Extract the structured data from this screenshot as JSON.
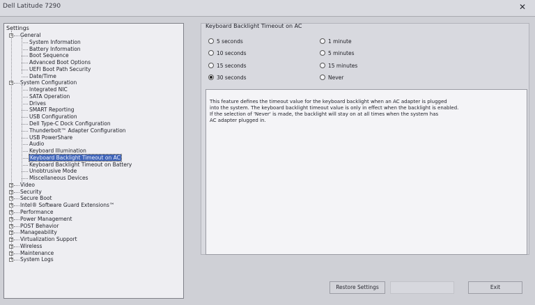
{
  "window": {
    "title": "Dell Latitude 7290",
    "close_glyph": "✕"
  },
  "tree": {
    "root_label": "Settings",
    "items": [
      {
        "label": "General",
        "level": 0,
        "expander": "−"
      },
      {
        "label": "System Information",
        "level": 1
      },
      {
        "label": "Battery Information",
        "level": 1
      },
      {
        "label": "Boot Sequence",
        "level": 1
      },
      {
        "label": "Advanced Boot Options",
        "level": 1
      },
      {
        "label": "UEFI Boot Path Security",
        "level": 1
      },
      {
        "label": "Date/Time",
        "level": 1
      },
      {
        "label": "System Configuration",
        "level": 0,
        "expander": "−"
      },
      {
        "label": "Integrated NIC",
        "level": 1
      },
      {
        "label": "SATA Operation",
        "level": 1
      },
      {
        "label": "Drives",
        "level": 1
      },
      {
        "label": "SMART Reporting",
        "level": 1
      },
      {
        "label": "USB Configuration",
        "level": 1
      },
      {
        "label": "Dell Type-C Dock Configuration",
        "level": 1
      },
      {
        "label": "Thunderbolt™ Adapter Configuration",
        "level": 1
      },
      {
        "label": "USB PowerShare",
        "level": 1
      },
      {
        "label": "Audio",
        "level": 1
      },
      {
        "label": "Keyboard Illumination",
        "level": 1
      },
      {
        "label": "Keyboard Backlight Timeout on AC",
        "level": 1,
        "selected": true
      },
      {
        "label": "Keyboard Backlight Timeout on Battery",
        "level": 1
      },
      {
        "label": "Unobtrusive Mode",
        "level": 1
      },
      {
        "label": "Miscellaneous Devices",
        "level": 1
      },
      {
        "label": "Video",
        "level": 0,
        "expander": "+"
      },
      {
        "label": "Security",
        "level": 0,
        "expander": "+"
      },
      {
        "label": "Secure Boot",
        "level": 0,
        "expander": "+"
      },
      {
        "label": "Intel® Software Guard Extensions™",
        "level": 0,
        "expander": "+"
      },
      {
        "label": "Performance",
        "level": 0,
        "expander": "+"
      },
      {
        "label": "Power Management",
        "level": 0,
        "expander": "+"
      },
      {
        "label": "POST Behavior",
        "level": 0,
        "expander": "+"
      },
      {
        "label": "Manageability",
        "level": 0,
        "expander": "+"
      },
      {
        "label": "Virtualization Support",
        "level": 0,
        "expander": "+"
      },
      {
        "label": "Wireless",
        "level": 0,
        "expander": "+"
      },
      {
        "label": "Maintenance",
        "level": 0,
        "expander": "+"
      },
      {
        "label": "System Logs",
        "level": 0,
        "expander": "+"
      }
    ]
  },
  "setting": {
    "title": "Keyboard Backlight Timeout on AC",
    "options_left": [
      {
        "label": "5 seconds",
        "checked": false
      },
      {
        "label": "10 seconds",
        "checked": false
      },
      {
        "label": "15 seconds",
        "checked": false
      },
      {
        "label": "30 seconds",
        "checked": true
      }
    ],
    "options_right": [
      {
        "label": "1 minute",
        "checked": false
      },
      {
        "label": "5 minutes",
        "checked": false
      },
      {
        "label": "15 minutes",
        "checked": false
      },
      {
        "label": "Never",
        "checked": false
      }
    ],
    "description": [
      "This feature defines the timeout value for the keyboard backlight when an AC adapter is plugged",
      "into the system. The keyboard backlight timeout value is only in effect when the backlight is enabled.",
      "If the selection of 'Never' is made, the backlight will stay on at all times when the system has",
      "AC adapter plugged in."
    ]
  },
  "buttons": {
    "restore": "Restore Settings",
    "blank": "",
    "exit": "Exit"
  }
}
